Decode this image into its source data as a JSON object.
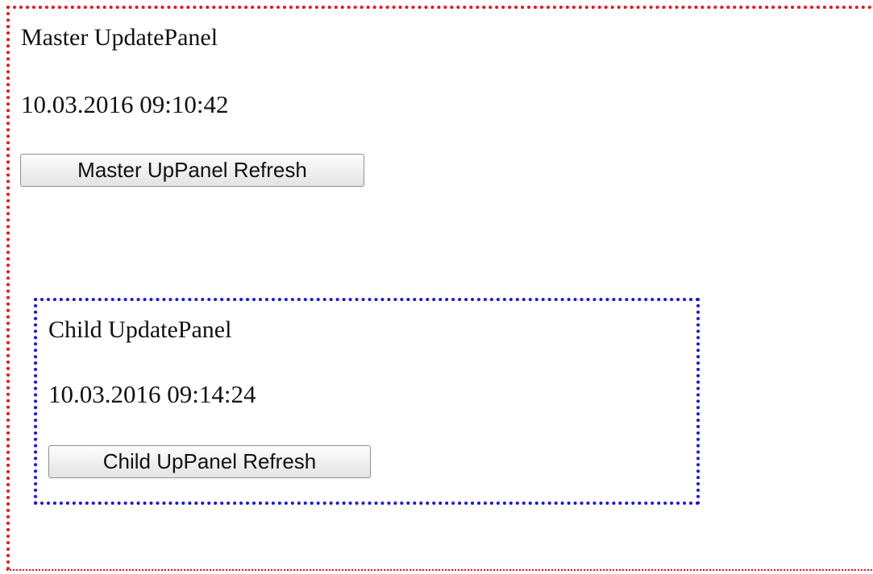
{
  "master_panel": {
    "title": "Master UpdatePanel",
    "timestamp": "10.03.2016 09:10:42",
    "refresh_button_label": "Master UpPanel Refresh",
    "border_color": "#ee1111"
  },
  "child_panel": {
    "title": "Child UpdatePanel",
    "timestamp": "10.03.2016 09:14:24",
    "refresh_button_label": "Child UpPanel Refresh",
    "border_color": "#1414e6"
  }
}
